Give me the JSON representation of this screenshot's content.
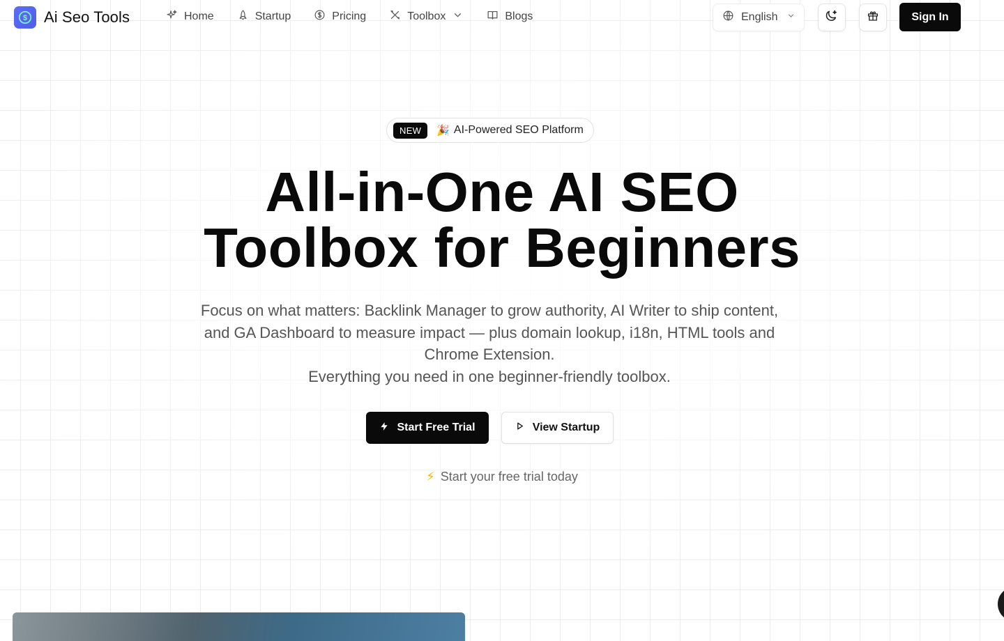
{
  "brand": {
    "name": "Ai Seo Tools"
  },
  "nav": {
    "items": [
      {
        "label": "Home",
        "icon": "sparkles-icon"
      },
      {
        "label": "Startup",
        "icon": "rocket-icon"
      },
      {
        "label": "Pricing",
        "icon": "dollar-circle-icon"
      },
      {
        "label": "Toolbox",
        "icon": "tools-icon",
        "has_dropdown": true
      },
      {
        "label": "Blogs",
        "icon": "book-icon"
      }
    ]
  },
  "header": {
    "language": "English",
    "theme_toggle_icon": "moon-icon",
    "gift_icon": "gift-icon",
    "sign_in_label": "Sign In"
  },
  "hero": {
    "badge_new": "NEW",
    "badge_emoji": "🎉",
    "badge_text": "AI-Powered SEO Platform",
    "title_line1": "All-in-One AI SEO",
    "title_line2": "Toolbox for Beginners",
    "description": "Focus on what matters: Backlink Manager to grow authority, AI Writer to ship content, and GA Dashboard to measure impact — plus domain lookup, i18n, HTML tools and Chrome Extension.",
    "tagline": "Everything you need in one beginner-friendly toolbox.",
    "primary_cta": "Start Free Trial",
    "secondary_cta": "View Startup",
    "trial_note_emoji": "⚡",
    "trial_note": "Start your free trial today"
  },
  "colors": {
    "accent": "#0a0a0a",
    "logo": "#5b6cf5",
    "grid": "#ececec"
  }
}
